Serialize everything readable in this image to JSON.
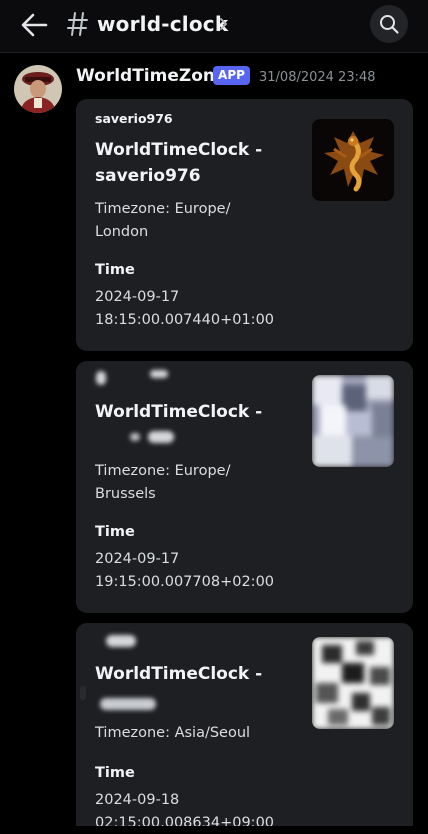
{
  "header": {
    "channel": "world-clock",
    "back_icon": "arrow-left-icon",
    "hash_icon": "hash-icon",
    "chevron_icon": "chevron-right-icon",
    "search_icon": "search-icon"
  },
  "message": {
    "author": "WorldTimeZone",
    "badge": "APP",
    "timestamp": "31/08/2024 23:48"
  },
  "embeds": [
    {
      "author": "saverio976",
      "title_line1": "WorldTimeClock -",
      "title_line2": "saverio976",
      "timezone_line1": "Timezone: Europe/",
      "timezone_line2": "London",
      "time_label": "Time",
      "time_line1": "2024-09-17",
      "time_line2": "18:15:00.007440+01:00"
    },
    {
      "author": "",
      "title_line1": "WorldTimeClock -",
      "title_line2": "",
      "timezone_line1": "Timezone: Europe/",
      "timezone_line2": "Brussels",
      "time_label": "Time",
      "time_line1": "2024-09-17",
      "time_line2": "19:15:00.007708+02:00"
    },
    {
      "author": "",
      "title_line1": "WorldTimeClock -",
      "title_line2": "",
      "timezone_line1": "Timezone: Asia/Seoul",
      "timezone_line2": "",
      "time_label": "Time",
      "time_line1": "2024-09-18",
      "time_line2": "02:15:00.008634+09:00"
    }
  ],
  "colors": {
    "background": "#000000",
    "embed": "#1e1f22",
    "app_badge": "#5865f2",
    "text": "#dbdee1"
  }
}
